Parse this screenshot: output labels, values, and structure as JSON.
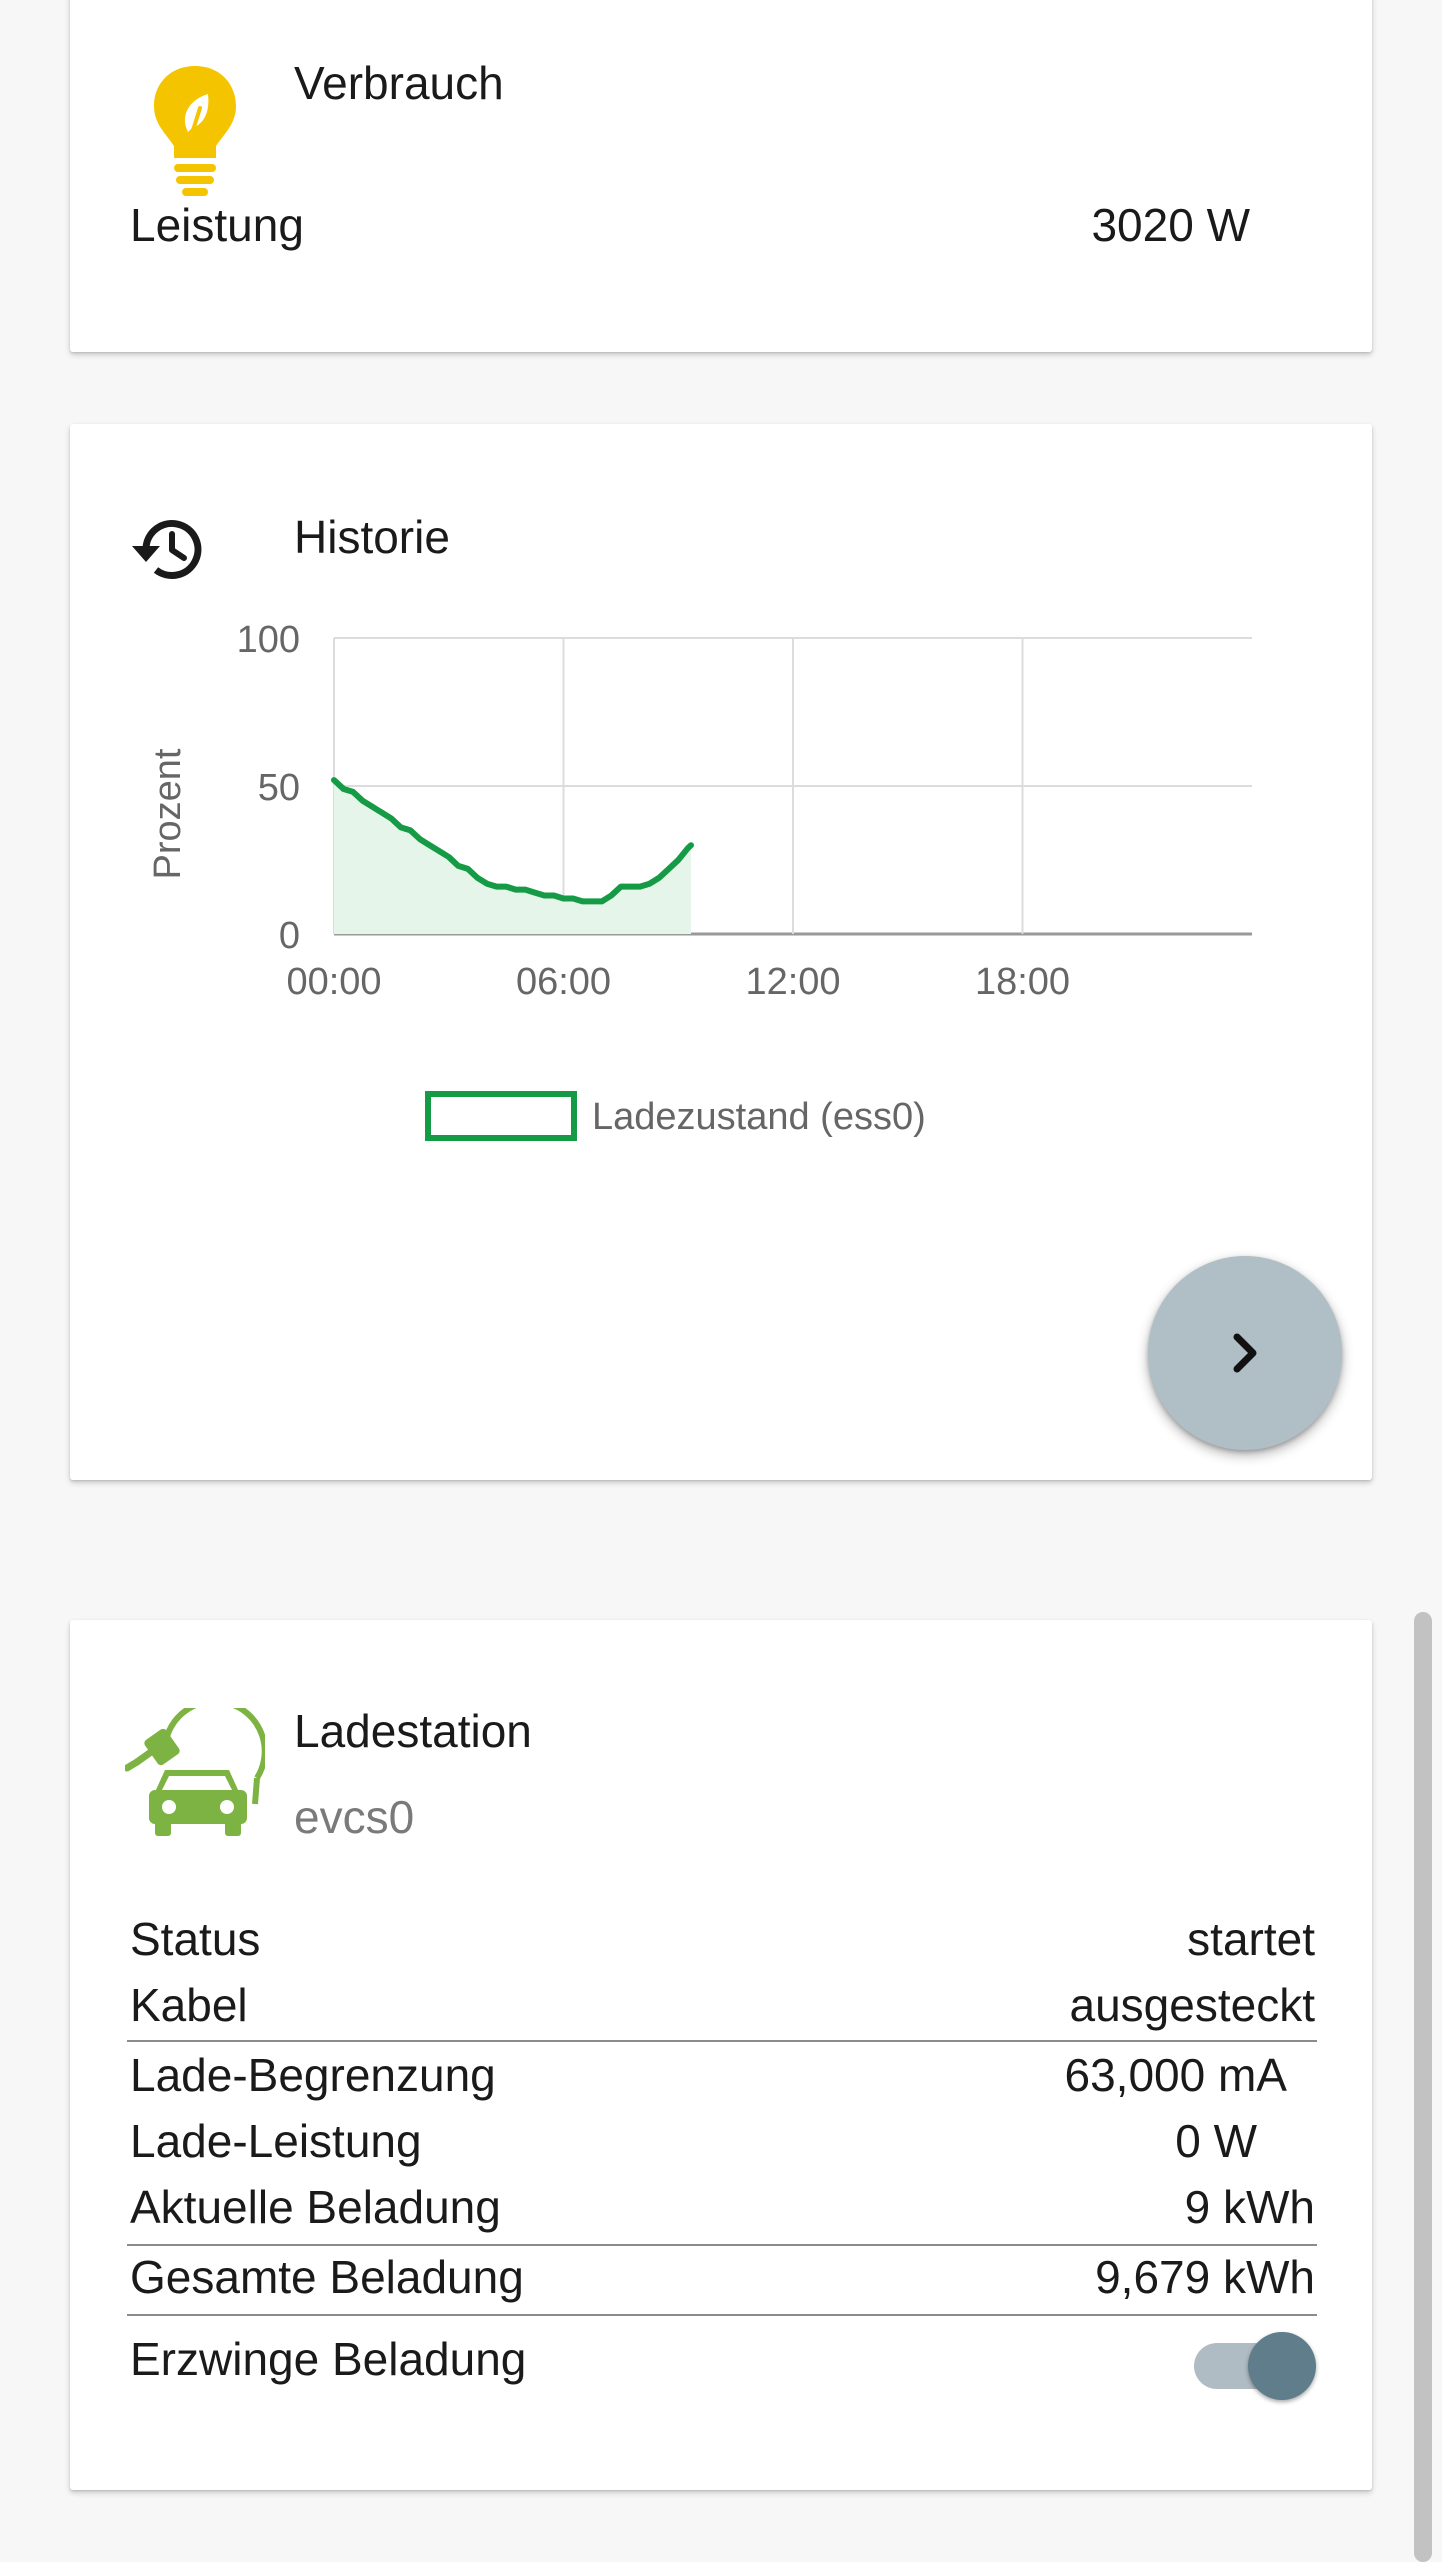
{
  "verbrauch": {
    "title": "Verbrauch",
    "icon": "lightbulb-leaf-icon",
    "icon_color": "#f5c400",
    "label": "Leistung",
    "value": "3020 W"
  },
  "historie": {
    "title": "Historie",
    "icon": "history-icon",
    "chart_data": {
      "type": "area",
      "ylabel": "Prozent",
      "xlabel": "",
      "ylim": [
        0,
        100
      ],
      "yticks": [
        "100",
        "50",
        "0"
      ],
      "xticks": [
        "00:00",
        "06:00",
        "12:00",
        "18:00"
      ],
      "x_range": [
        "00:00",
        "24:00"
      ],
      "grid": true,
      "legend_position": "bottom-center",
      "series": [
        {
          "name": "Ladezustand (ess0)",
          "color": "#159b45",
          "fill": "#e6f5ea",
          "x": [
            "00:00",
            "00:15",
            "00:30",
            "00:45",
            "01:00",
            "01:15",
            "01:30",
            "01:45",
            "02:00",
            "02:15",
            "02:30",
            "02:45",
            "03:00",
            "03:15",
            "03:30",
            "03:45",
            "04:00",
            "04:15",
            "04:30",
            "04:45",
            "05:00",
            "05:15",
            "05:30",
            "05:45",
            "06:00",
            "06:15",
            "06:30",
            "06:45",
            "07:00",
            "07:15",
            "07:30",
            "07:45",
            "08:00",
            "08:15",
            "08:30",
            "08:45",
            "09:00",
            "09:15",
            "09:20"
          ],
          "values": [
            52,
            49,
            48,
            45,
            43,
            41,
            39,
            36,
            35,
            32,
            30,
            28,
            26,
            23,
            22,
            19,
            17,
            16,
            16,
            15,
            15,
            14,
            13,
            13,
            12,
            12,
            11,
            11,
            11,
            13,
            16,
            16,
            16,
            17,
            19,
            22,
            25,
            29,
            30
          ]
        }
      ]
    },
    "next_button_icon": "chevron-right-icon"
  },
  "ladestation": {
    "title": "Ladestation",
    "subtitle": "evcs0",
    "icon": "ev-charging-car-icon",
    "icon_color": "#7cb342",
    "rows": [
      {
        "label": "Status",
        "value": "startet"
      },
      {
        "label": "Kabel",
        "value": "ausgesteckt"
      },
      {
        "label": "Lade-Begrenzung",
        "value": "63,000 mA"
      },
      {
        "label": "Lade-Leistung",
        "value": "0 W"
      },
      {
        "label": "Aktuelle Beladung",
        "value": "9 kWh"
      },
      {
        "label": "Gesamte Beladung",
        "value": "9,679 kWh"
      }
    ],
    "force_label": "Erzwinge Beladung",
    "force_enabled": true,
    "toggle_color": "#607d8b"
  }
}
